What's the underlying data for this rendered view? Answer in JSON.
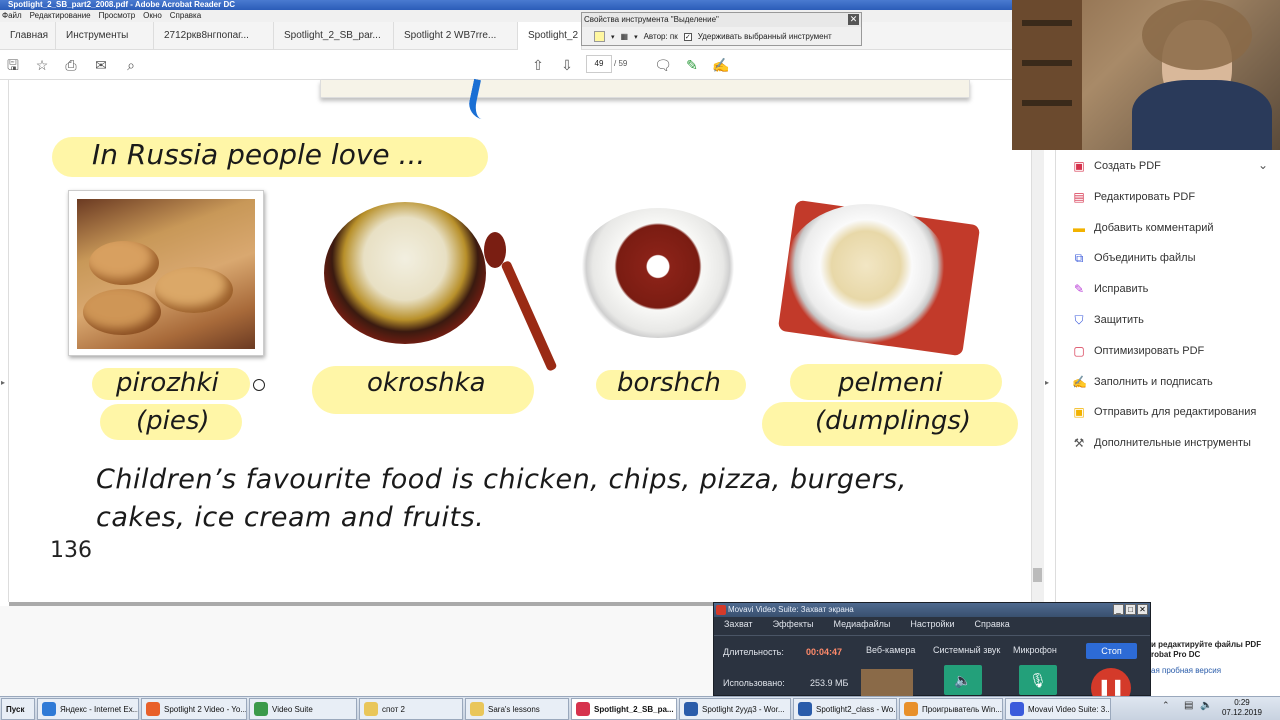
{
  "window": {
    "title": "Spotlight_2_SB_part2_2008.pdf - Adobe Acrobat Reader DC",
    "menu": [
      "Файл",
      "Редактирование",
      "Просмотр",
      "Окно",
      "Справка"
    ]
  },
  "tabs": [
    "Главная",
    "Инструменты",
    "2712ркв8нгпопаг...",
    "Spotlight_2_SB_par...",
    "Spotlight 2 WB7rre...",
    "Spotlight_2"
  ],
  "toolbar": {
    "page_current": "49",
    "page_total": "/ 59"
  },
  "tool_properties": {
    "title": "Свойства инструмента \"Выделение\"",
    "author_label": "Автор: пк",
    "keep_tool_label": "Удерживать выбранный инструмент",
    "keep_tool_checked": true
  },
  "document": {
    "heading": "In Russia people love ...",
    "foods": [
      {
        "name": "pirozhki",
        "translation": "(pies)"
      },
      {
        "name": "okroshka",
        "translation": ""
      },
      {
        "name": "borshch",
        "translation": ""
      },
      {
        "name": "pelmeni",
        "translation": "(dumplings)"
      }
    ],
    "sentence_line1": "Children’s favourite food is chicken, chips, pizza, burgers,",
    "sentence_line2": "cakes, ice cream and fruits.",
    "page_number": "136"
  },
  "right_panel": {
    "items": [
      {
        "label": "Создать PDF",
        "icon": "create-pdf-icon",
        "color": "#d6334d"
      },
      {
        "label": "Редактировать PDF",
        "icon": "edit-pdf-icon",
        "color": "#d6334d"
      },
      {
        "label": "Добавить комментарий",
        "icon": "comment-icon",
        "color": "#f2b200"
      },
      {
        "label": "Объединить файлы",
        "icon": "combine-icon",
        "color": "#3b5bdb"
      },
      {
        "label": "Исправить",
        "icon": "fix-icon",
        "color": "#b83ad6"
      },
      {
        "label": "Защитить",
        "icon": "shield-icon",
        "color": "#3b5bdb"
      },
      {
        "label": "Оптимизировать PDF",
        "icon": "optimize-icon",
        "color": "#d6334d"
      },
      {
        "label": "Заполнить и подписать",
        "icon": "sign-icon",
        "color": "#b83ad6"
      },
      {
        "label": "Отправить для редактирования",
        "icon": "send-icon",
        "color": "#f2b200"
      },
      {
        "label": "Дополнительные инструменты",
        "icon": "tools-icon",
        "color": "#555555"
      }
    ]
  },
  "behind_text": {
    "line1": "и редактируйте файлы PDF",
    "line2": "robat Pro DC",
    "line3": "ая пробная версия"
  },
  "movavi": {
    "title": "Movavi Video Suite: Захват экрана",
    "menu": [
      "Захват",
      "Эффекты",
      "Медиафайлы",
      "Настройки",
      "Справка"
    ],
    "duration_label": "Длительность:",
    "duration_value": "00:04:47",
    "used_label": "Использовано:",
    "used_value": "253.9 МБ",
    "webcam_label": "Веб-камера",
    "system_sound_label": "Системный звук",
    "mic_label": "Микрофон",
    "stop_label": "Стоп"
  },
  "taskbar": {
    "start": "Пуск",
    "tasks": [
      {
        "label": "Яндекс - Internet Ex...",
        "color": "#2f7ad6"
      },
      {
        "label": "Spotlight 2 Video - Yo...",
        "color": "#e8602a"
      },
      {
        "label": "Video Suite",
        "color": "#3b9a4a"
      },
      {
        "label": "спот 2",
        "color": "#e9c65a"
      },
      {
        "label": "Sara's lessons",
        "color": "#e9c65a"
      },
      {
        "label": "Spotlight_2_SB_pa...",
        "color": "#d6334d"
      },
      {
        "label": "Spotlight 2ууд3 - Wor...",
        "color": "#2a5caa"
      },
      {
        "label": "Spotlight2_class - Wo...",
        "color": "#2a5caa"
      },
      {
        "label": "Проигрыватель Win...",
        "color": "#e8902a"
      },
      {
        "label": "Movavi Video Suite: 3...",
        "color": "#3b5bdb"
      }
    ],
    "clock_time": "0:29",
    "clock_date": "07.12.2019"
  }
}
